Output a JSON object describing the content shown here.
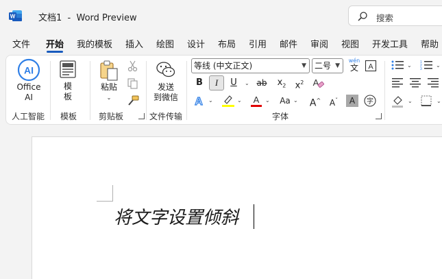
{
  "window": {
    "title": "文档1  -  Word Preview",
    "search_placeholder": "搜索"
  },
  "tabs": [
    {
      "label": "文件"
    },
    {
      "label": "开始",
      "active": true
    },
    {
      "label": "我的模板"
    },
    {
      "label": "插入"
    },
    {
      "label": "绘图"
    },
    {
      "label": "设计"
    },
    {
      "label": "布局"
    },
    {
      "label": "引用"
    },
    {
      "label": "邮件"
    },
    {
      "label": "审阅"
    },
    {
      "label": "视图"
    },
    {
      "label": "开发工具"
    },
    {
      "label": "帮助"
    }
  ],
  "ribbon": {
    "office_ai": {
      "line1": "Office",
      "line2": "AI",
      "group": "人工智能"
    },
    "template": {
      "line1": "模",
      "line2": "板",
      "group": "模板"
    },
    "clipboard": {
      "paste": "粘贴",
      "group": "剪贴板"
    },
    "transfer": {
      "line1": "发送",
      "line2": "到微信",
      "group": "文件传输"
    },
    "font": {
      "font_name": "等线 (中文正文)",
      "font_size": "二号",
      "phonetic": "wén",
      "phonetic_char": "文",
      "bold": "B",
      "italic": "I",
      "underline": "U",
      "strike": "ab",
      "subscript": "x",
      "superscript": "x",
      "sub_mark": "2",
      "sup_mark": "2",
      "change_case": "Aa",
      "grow": "A",
      "shrink": "A",
      "group": "字体"
    }
  },
  "document": {
    "text": "将文字设置倾斜"
  },
  "colors": {
    "accent": "#185abd",
    "highlight": "#ffff00",
    "font_color": "#e00000"
  }
}
